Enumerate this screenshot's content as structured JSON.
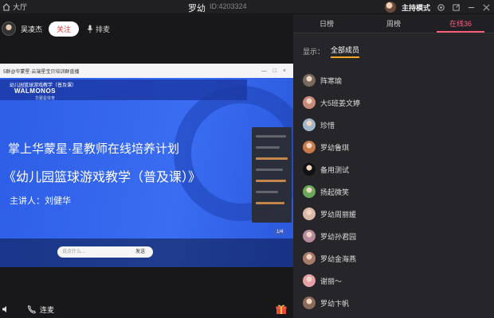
{
  "titlebar": {
    "home_label": "大厅",
    "title": "罗幼",
    "id_text": "ID:4203324",
    "host_mode_label": "主持模式"
  },
  "streamer": {
    "name": "吴凌杰",
    "follow_label": "关注",
    "queue_label": "排麦"
  },
  "video": {
    "window_title": "5群@华蒙星·云端星宝贝培训群直播",
    "slide_header": "幼儿园篮球游戏教学（普及课）",
    "brand_logo": "WALMONOS",
    "brand_sub": "华蒙星体育",
    "line1": "掌上华蒙星·星教师在线培养计划",
    "line2": "《幼儿园篮球游戏教学（普及课）》",
    "line3": "主讲人：刘健华",
    "input_placeholder": "说点什么...",
    "send_label": "发送",
    "page_indicator": "1/4"
  },
  "bottom": {
    "mic_label": "连麦"
  },
  "sidebar": {
    "tabs": [
      {
        "label": "日榜"
      },
      {
        "label": "周榜"
      },
      {
        "label": "在线36"
      }
    ],
    "active_tab": 2,
    "filter_label": "显示：",
    "filter_value": "全部成员",
    "members": [
      {
        "name": "阵寒瑜",
        "avatar_color": "#7a6a5e"
      },
      {
        "name": "大5班姜文婷",
        "avatar_color": "#c98a7a"
      },
      {
        "name": "珍惜",
        "avatar_color": "#9fb7c9"
      },
      {
        "name": "罗幼鲁琪",
        "avatar_color": "#c77a4a"
      },
      {
        "name": "备用测试",
        "avatar_color": "#111111"
      },
      {
        "name": "扬起微笑",
        "avatar_color": "#6aa85a"
      },
      {
        "name": "罗幼周丽媛",
        "avatar_color": "#d9b9a8"
      },
      {
        "name": "罗幼孙君园",
        "avatar_color": "#b48a9a"
      },
      {
        "name": "罗幼金海燕",
        "avatar_color": "#a87a68"
      },
      {
        "name": "谢丽～",
        "avatar_color": "#e6a0a8"
      },
      {
        "name": "罗幼卞帆",
        "avatar_color": "#8a6a5a"
      }
    ]
  }
}
